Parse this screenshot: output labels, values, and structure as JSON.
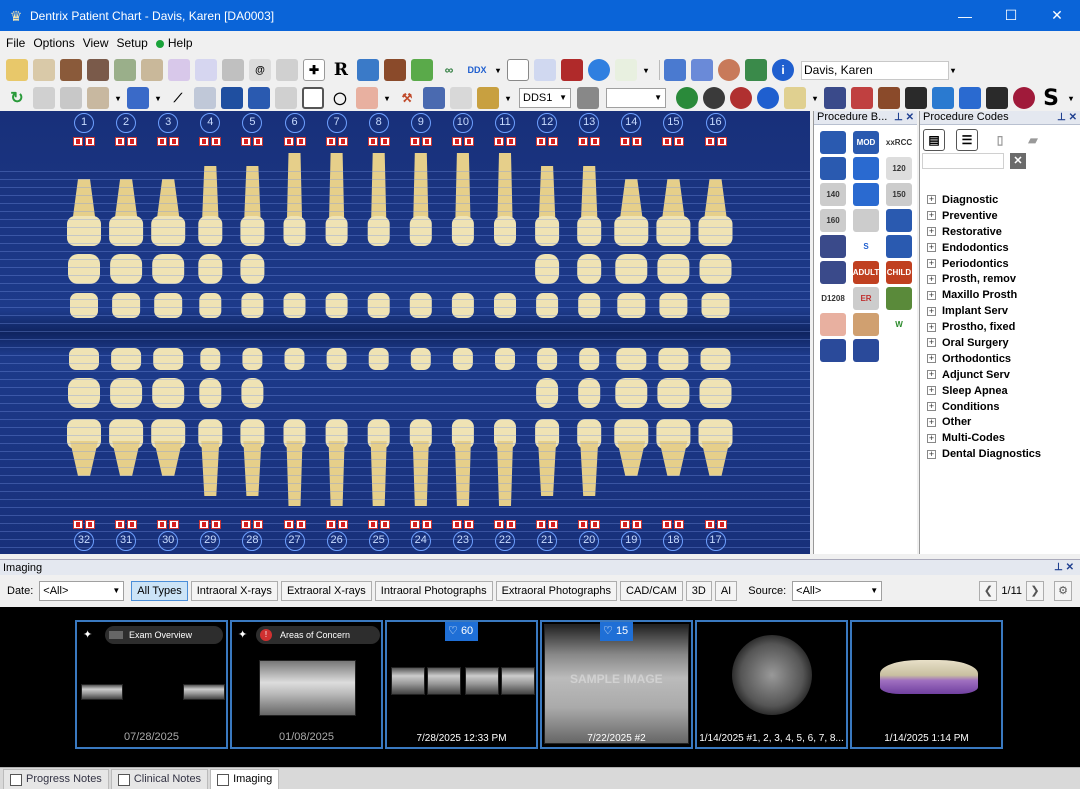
{
  "window": {
    "title": "Dentrix Patient Chart - Davis, Karen [DA0003]"
  },
  "menu": {
    "file": "File",
    "options": "Options",
    "view": "View",
    "setup": "Setup",
    "help": "Help"
  },
  "toolbar": {
    "patient_name": "Davis, Karen",
    "provider": "DDS1",
    "x_label": "R",
    "ddx_label": "DDX",
    "s_label": "S"
  },
  "chart": {
    "upper_teeth": [
      "1",
      "2",
      "3",
      "4",
      "5",
      "6",
      "7",
      "8",
      "9",
      "10",
      "11",
      "12",
      "13",
      "14",
      "15",
      "16"
    ],
    "lower_teeth": [
      "32",
      "31",
      "30",
      "29",
      "28",
      "27",
      "26",
      "25",
      "24",
      "23",
      "22",
      "21",
      "20",
      "19",
      "18",
      "17"
    ]
  },
  "procedure_buttons": {
    "title": "Procedure B...",
    "items": [
      "",
      "MOD",
      "xxRCC",
      "",
      "",
      "120",
      "140",
      "",
      "150",
      "160",
      "",
      "",
      "",
      "S",
      "",
      "",
      "ADULT",
      "CHILD",
      "D1208",
      "ER",
      "",
      "",
      "",
      "W",
      "",
      ""
    ]
  },
  "procedure_codes": {
    "title": "Procedure Codes",
    "categories": [
      "Diagnostic",
      "Preventive",
      "Restorative",
      "Endodontics",
      "Periodontics",
      "Prosth, remov",
      "Maxillo Prosth",
      "Implant Serv",
      "Prostho, fixed",
      "Oral Surgery",
      "Orthodontics",
      "Adjunct Serv",
      "Sleep Apnea",
      "Conditions",
      "Other",
      "Multi-Codes",
      "Dental Diagnostics"
    ]
  },
  "imaging": {
    "title": "Imaging",
    "date_label": "Date:",
    "date_value": "<All>",
    "types": [
      "All Types",
      "Intraoral X-rays",
      "Extraoral X-rays",
      "Intraoral Photographs",
      "Extraoral Photographs",
      "CAD/CAM",
      "3D",
      "AI"
    ],
    "source_label": "Source:",
    "source_value": "<All>",
    "page": "1/11",
    "thumbnails": [
      {
        "pill": "Exam Overview",
        "caption": "07/28/2025"
      },
      {
        "pill": "Areas of Concern",
        "caption": "01/08/2025"
      },
      {
        "badge": "60",
        "caption": "7/28/2025 12:33 PM"
      },
      {
        "badge": "15",
        "caption": "7/22/2025 #2",
        "watermark": "SAMPLE IMAGE"
      },
      {
        "caption": "1/14/2025 #1, 2, 3, 4, 5, 6, 7, 8..."
      },
      {
        "caption": "1/14/2025 1:14 PM"
      }
    ]
  },
  "bottom_tabs": [
    "Progress Notes",
    "Clinical Notes",
    "Imaging"
  ]
}
